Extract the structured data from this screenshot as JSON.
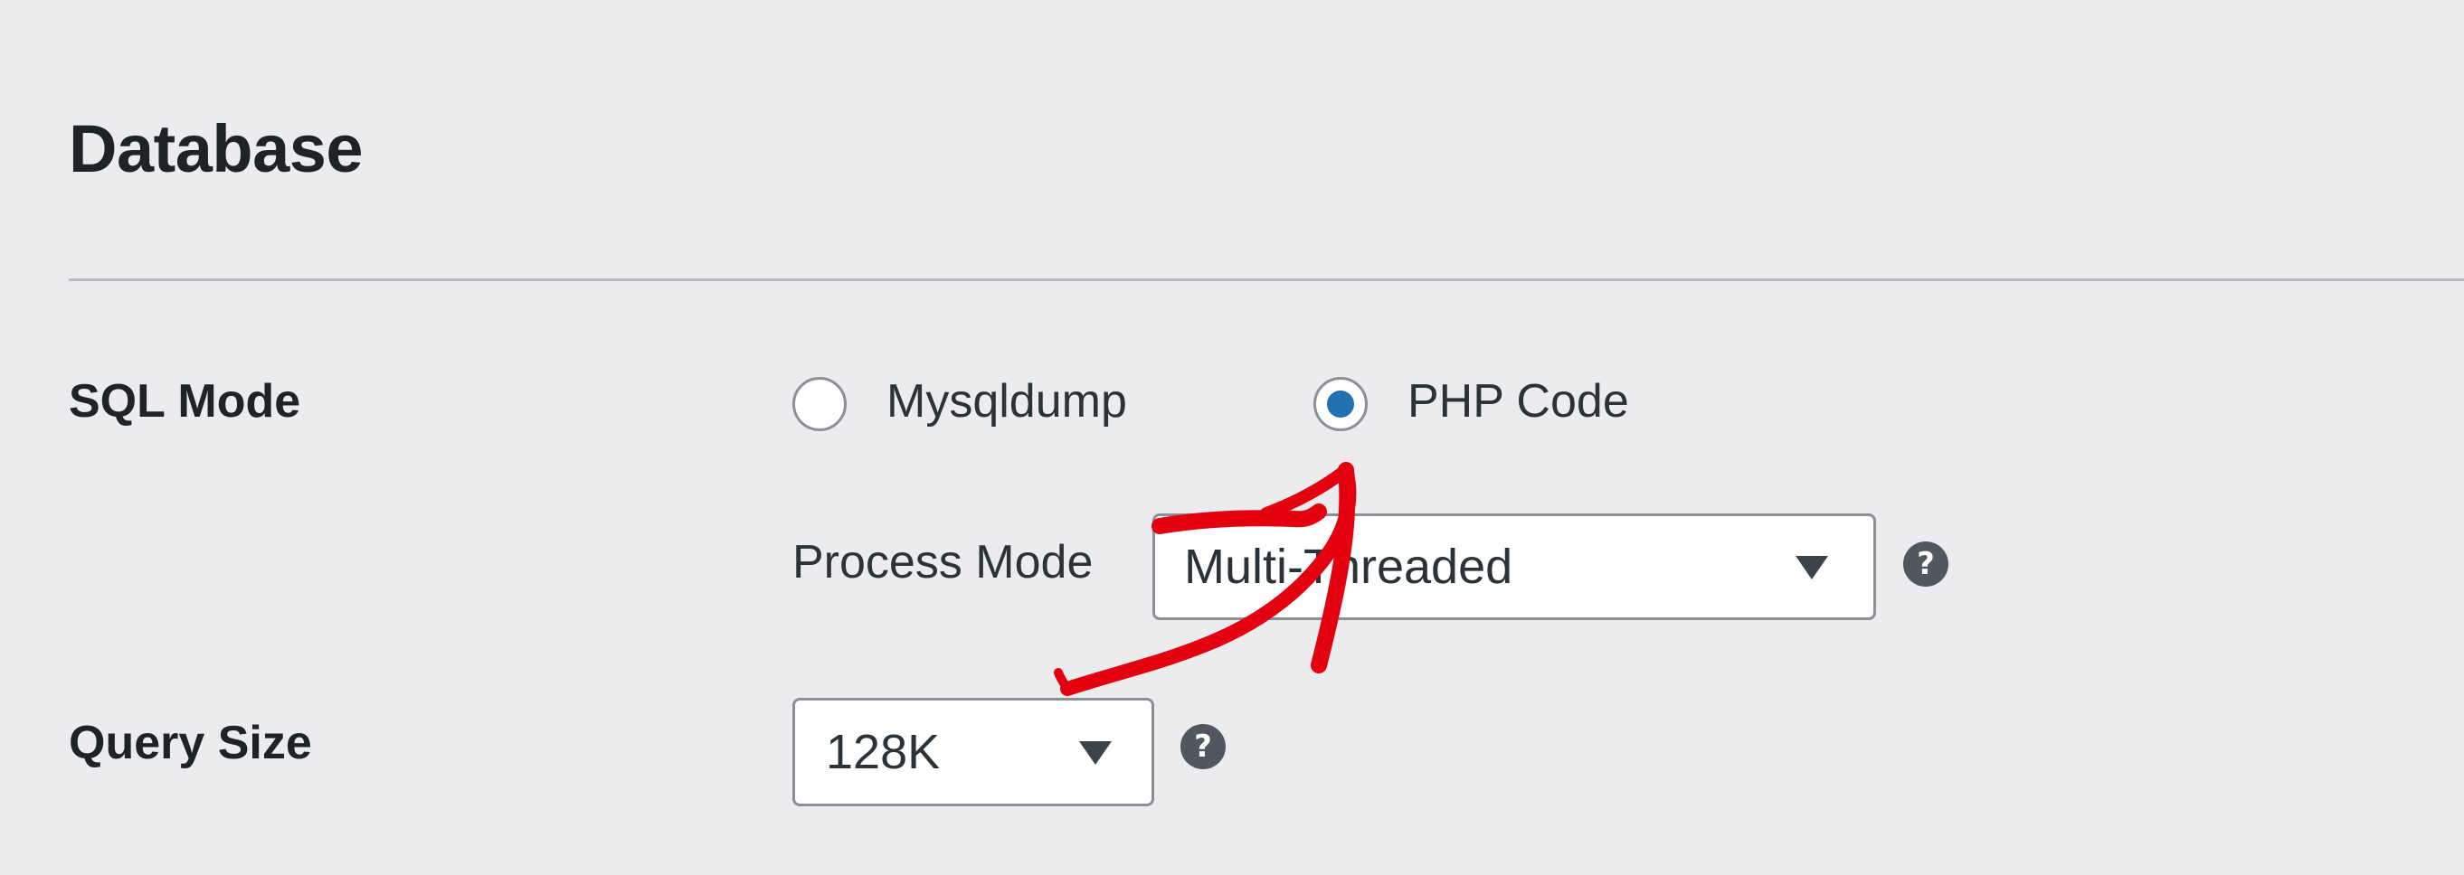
{
  "section": {
    "title": "Database"
  },
  "sql_mode": {
    "label": "SQL Mode",
    "options": [
      {
        "label": "Mysqldump",
        "selected": false
      },
      {
        "label": "PHP Code",
        "selected": true
      }
    ],
    "process_mode": {
      "label": "Process Mode",
      "value": "Multi-Threaded",
      "help_icon": "question-mark"
    }
  },
  "query_size": {
    "label": "Query Size",
    "value": "128K",
    "help_icon": "question-mark"
  },
  "annotation": {
    "type": "hand-drawn-arrow",
    "color": "#e3000f"
  },
  "colors": {
    "background": "#ececee",
    "radio_selected": "#2271b1",
    "annotation": "#e3000f"
  }
}
